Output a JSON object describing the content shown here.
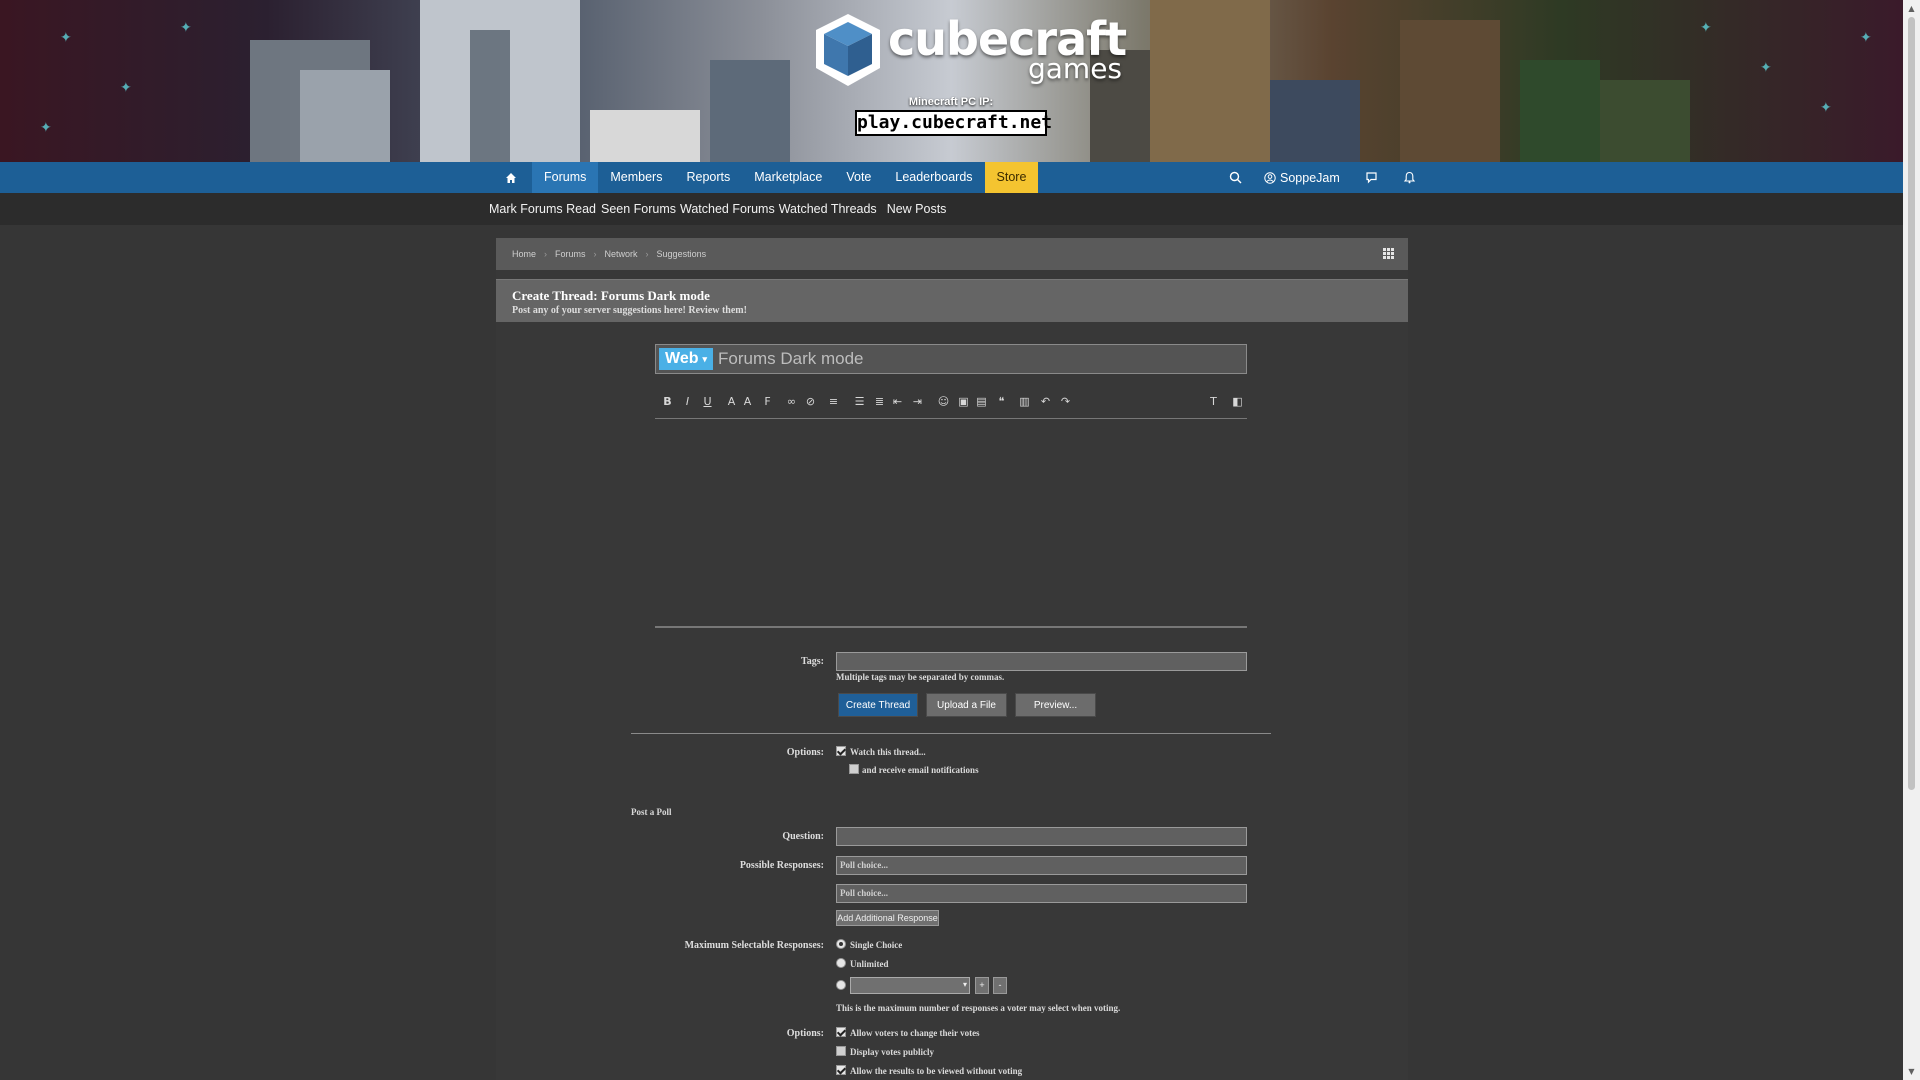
{
  "banner": {
    "logo_name": "cubecraft",
    "logo_sub": "games",
    "ip_label": "Minecraft PC IP:",
    "ip_value": "play.cubecraft.net"
  },
  "nav": {
    "items": [
      {
        "label": "Forums",
        "active": true
      },
      {
        "label": "Members"
      },
      {
        "label": "Reports"
      },
      {
        "label": "Marketplace"
      },
      {
        "label": "Vote"
      },
      {
        "label": "Leaderboards"
      },
      {
        "label": "Store"
      }
    ],
    "username": "SoppeJam",
    "icons": [
      "home-icon",
      "search-icon",
      "user-icon",
      "chat-icon",
      "bell-icon"
    ]
  },
  "subnav": {
    "links": [
      "Mark Forums Read",
      "Seen Forums",
      "Watched Forums",
      "Watched Threads",
      "New Posts"
    ]
  },
  "breadcrumb": [
    "Home",
    "Forums",
    "Network",
    "Suggestions"
  ],
  "page": {
    "title": "Create Thread: Forums Dark mode",
    "subtitle": "Post any of your server suggestions here! Review them!"
  },
  "thread": {
    "prefix": "Web",
    "title_value": "Forums Dark mode"
  },
  "form": {
    "tags_label": "Tags:",
    "tags_hint": "Multiple tags may be separated by commas.",
    "buttons": {
      "create": "Create Thread",
      "upload": "Upload a File",
      "preview": "Preview..."
    },
    "options_label": "Options:",
    "watch_label": "Watch this thread...",
    "email_label": "and receive email notifications",
    "poll_heading": "Post a Poll",
    "question_label": "Question:",
    "responses_label": "Possible Responses:",
    "response_placeholder": "Poll choice...",
    "add_response": "Add Additional Response",
    "max_label": "Maximum Selectable Responses:",
    "single_choice": "Single Choice",
    "unlimited": "Unlimited",
    "stepper_plus": "+",
    "stepper_minus": "-",
    "max_hint": "This is the maximum number of responses a voter may select when voting.",
    "poll_options_label": "Options:",
    "poll_opt1": "Allow voters to change their votes",
    "poll_opt2": "Display votes publicly",
    "poll_opt3": "Allow the results to be viewed without voting"
  },
  "colors": {
    "nav_blue": "#1d5f96",
    "store_yellow": "#f4c430",
    "prefix_blue": "#4ab0e6",
    "primary_button": "#1f5f98"
  }
}
